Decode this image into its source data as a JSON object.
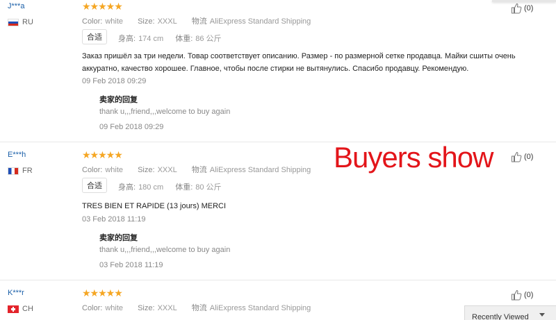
{
  "banner": "Buyers show",
  "recently_viewed": "Recently Viewed",
  "reviews": [
    {
      "user": "J***a",
      "country": "RU",
      "flag": "flag-ru",
      "stars": "★★★★★",
      "color_label": "Color:",
      "color_value": "white",
      "size_label": "Size:",
      "size_value": "XXXL",
      "logistics_label": "物流",
      "logistics_value": "AliExpress Standard Shipping",
      "fit_tag": "合适",
      "height_label": "身高:",
      "height_value": "174 cm",
      "weight_label": "体重:",
      "weight_value": "86 公斤",
      "text": "Заказ пришёл за три недели. Товар соответствует описанию. Размер - по размерной сетке продавца. Майки сшиты очень аккуратно, качество хорошее. Главное, чтобы после стирки не вытянулись. Спасибо продавцу. Рекомендую.",
      "date": "09 Feb 2018 09:29",
      "reply_title": "卖家的回复",
      "reply_text": "thank u,,,friend,,,welcome to buy again",
      "reply_date": "09 Feb 2018 09:29",
      "likes": "(0)"
    },
    {
      "user": "E***h",
      "country": "FR",
      "flag": "flag-fr",
      "stars": "★★★★★",
      "color_label": "Color:",
      "color_value": "white",
      "size_label": "Size:",
      "size_value": "XXXL",
      "logistics_label": "物流",
      "logistics_value": "AliExpress Standard Shipping",
      "fit_tag": "合适",
      "height_label": "身高:",
      "height_value": "180 cm",
      "weight_label": "体重:",
      "weight_value": "80 公斤",
      "text": "TRES BIEN ET RAPIDE (13 jours) MERCI",
      "date": "03 Feb 2018 11:19",
      "reply_title": "卖家的回复",
      "reply_text": "thank u,,,friend,,,welcome to buy again",
      "reply_date": "03 Feb 2018 11:19",
      "likes": "(0)"
    },
    {
      "user": "K***r",
      "country": "CH",
      "flag": "flag-ch",
      "stars": "★★★★★",
      "color_label": "Color:",
      "color_value": "white",
      "size_label": "Size:",
      "size_value": "XXXL",
      "logistics_label": "物流",
      "logistics_value": "AliExpress Standard Shipping",
      "likes": "(0)"
    }
  ]
}
